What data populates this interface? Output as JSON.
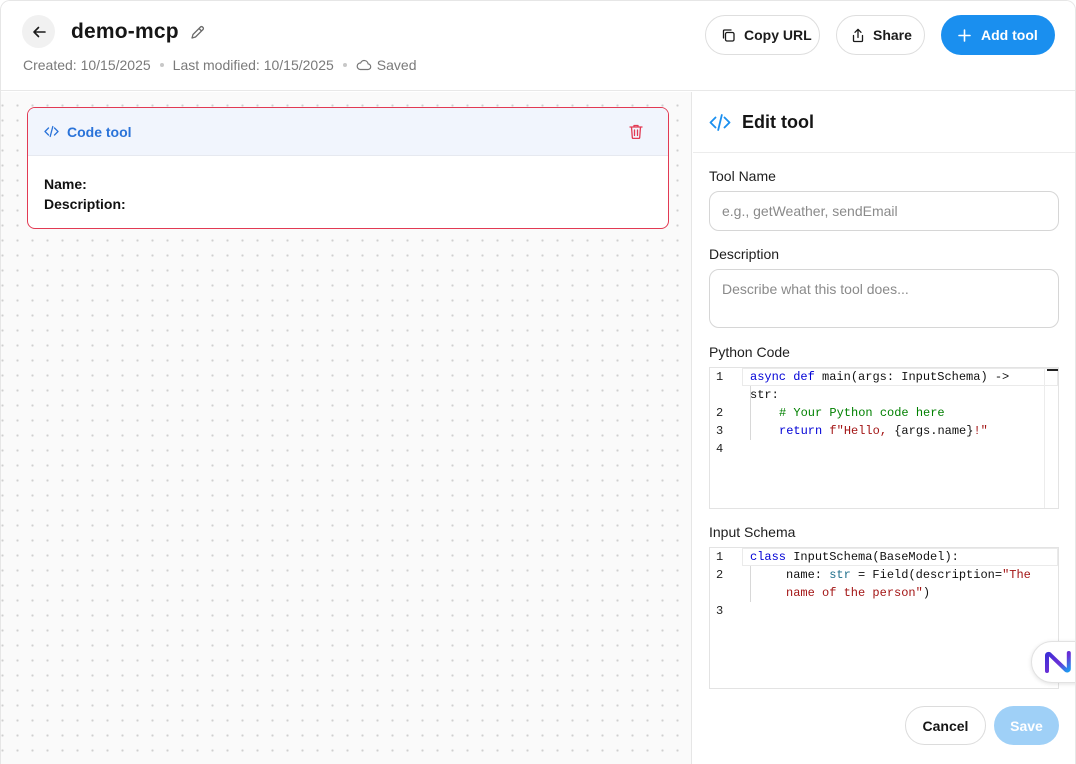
{
  "header": {
    "title": "demo-mcp",
    "created": "Created: 10/15/2025",
    "modified": "Last modified: 10/15/2025",
    "status": "Saved",
    "copy_url_label": "Copy URL",
    "share_label": "Share",
    "add_tool_label": "Add tool",
    "accent_color": "#1a8fef"
  },
  "canvas": {
    "node": {
      "title": "Code tool",
      "name_label": "Name:",
      "description_label": "Description:",
      "border_color": "#e23a53"
    }
  },
  "panel": {
    "title": "Edit tool",
    "tool_name_label": "Tool Name",
    "tool_name_placeholder": "e.g., getWeather, sendEmail",
    "description_label": "Description",
    "description_placeholder": "Describe what this tool does...",
    "python_code_label": "Python Code",
    "python_code": {
      "line_numbers": [
        "1",
        "2",
        "3",
        "4"
      ],
      "line1_kw1": "async",
      "line1_kw2": "def",
      "line1_fn": " main(args: InputSchema) ->",
      "line1_ret": "str:",
      "line2": "# Your Python code here",
      "line3_kw": "return",
      "line3_fstr": " f\"Hello, ",
      "line3_expr": "{args.name}",
      "line3_end": "!\""
    },
    "input_schema_label": "Input Schema",
    "input_schema": {
      "line_numbers": [
        "1",
        "2",
        "3"
      ],
      "line1_kw": "class",
      "line1_rest": " InputSchema(BaseModel):",
      "line2_a": "name: ",
      "line2_type": "str",
      "line2_b": " = Field(description=",
      "line2_str1": "\"The",
      "line2_str2": "name of the person\"",
      "line2_end": ")"
    },
    "cancel_label": "Cancel",
    "save_label": "Save"
  },
  "icons": {
    "back": "arrow-left-icon",
    "edit": "pencil-icon",
    "cloud": "cloud-icon",
    "copy": "copy-icon",
    "share": "share-icon",
    "add": "plus-icon",
    "code": "code-icon",
    "trash": "trash-icon",
    "assistant": "n-logo-icon"
  }
}
